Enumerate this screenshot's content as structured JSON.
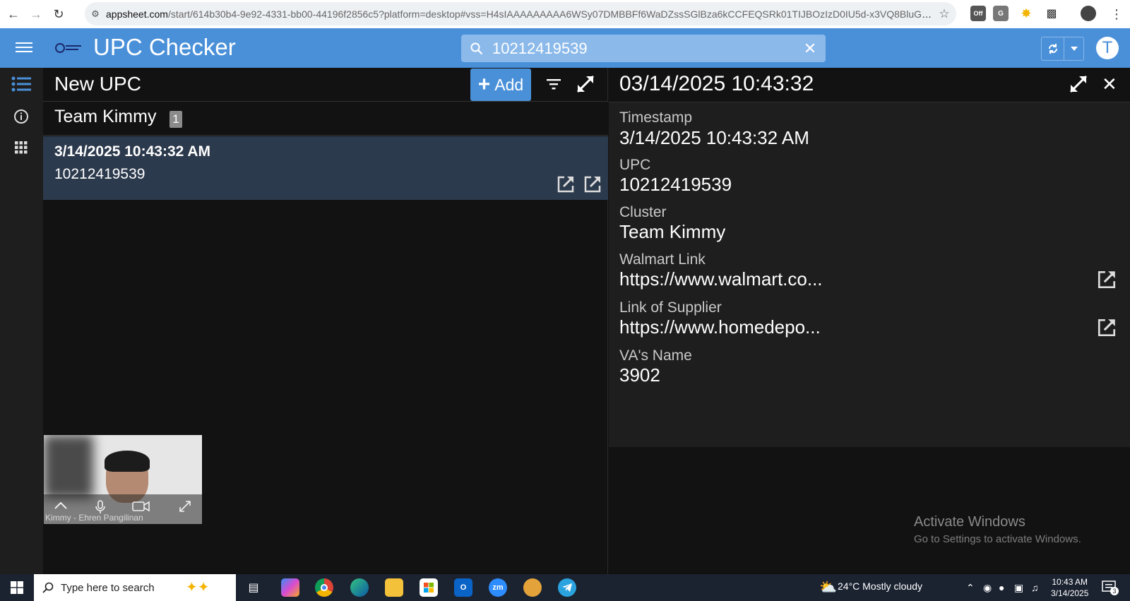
{
  "browser": {
    "url_host": "appsheet.com",
    "url_rest": "/start/614b30b4-9e92-4331-bb00-44196f2856c5?platform=desktop#vss=H4sIAAAAAAAAA6WSy07DMBBFf6WaDZssSGlBza6kCCFEQSRk01TIJBOzIzD0IU5d-x3VQ8BluGp...",
    "ext_off_label": "Off",
    "ext_g_label": "G"
  },
  "app": {
    "title": "UPC Checker",
    "search_value": "10212419539",
    "avatar_letter": "T"
  },
  "list": {
    "title": "New UPC",
    "add_label": "Add",
    "group_name": "Team Kimmy",
    "group_count": "1",
    "row": {
      "timestamp": "3/14/2025 10:43:32 AM",
      "upc": "10212419539"
    }
  },
  "video": {
    "caller_name": "Kimmy - Ehren Pangilinan"
  },
  "detail": {
    "title": "03/14/2025 10:43:32",
    "fields": [
      {
        "label": "Timestamp",
        "value": "3/14/2025 10:43:32 AM"
      },
      {
        "label": "UPC",
        "value": "10212419539"
      },
      {
        "label": "Cluster",
        "value": "Team Kimmy"
      },
      {
        "label": "Walmart Link",
        "value": "https://www.walmart.co..."
      },
      {
        "label": "Link of Supplier",
        "value": "https://www.homedepo..."
      },
      {
        "label": "VA's Name",
        "value": "3902"
      }
    ]
  },
  "watermark": {
    "line1": "Activate Windows",
    "line2": "Go to Settings to activate Windows."
  },
  "taskbar": {
    "search_placeholder": "Type here to search",
    "zoom_label": "zm",
    "outlook_label": "O",
    "weather": "24°C  Mostly cloudy",
    "time": "10:43 AM",
    "date": "3/14/2025",
    "notification_count": "3"
  }
}
